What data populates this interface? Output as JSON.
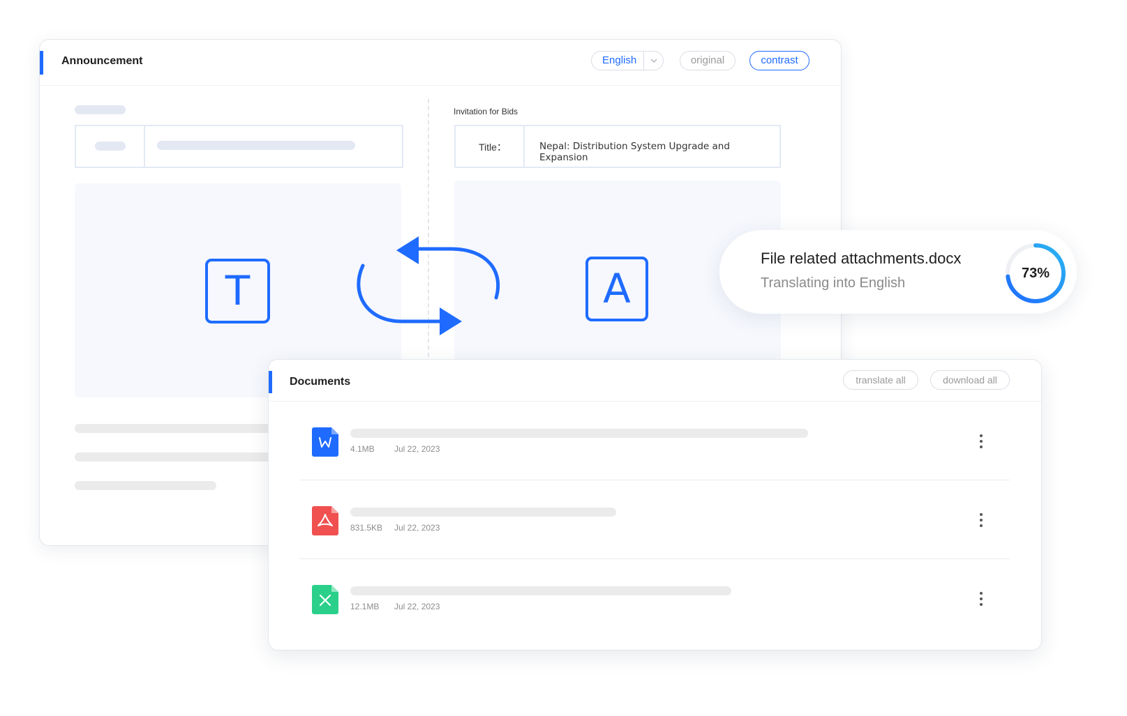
{
  "announcement": {
    "title": "Announcement",
    "language_select": "English",
    "original_label": "original",
    "contrast_label": "contrast",
    "section_label": "Invitation for Bids",
    "title_key": "Title：",
    "title_value": "Nepal: Distribution System Upgrade and Expansion",
    "source_letter": "T",
    "target_letter": "A"
  },
  "progress": {
    "filename": "File related attachments.docx",
    "status": "Translating into English",
    "percent_label": "73%",
    "percent": 73
  },
  "documents": {
    "title": "Documents",
    "translate_all": "translate all",
    "download_all": "download all",
    "files": [
      {
        "type": "word",
        "size": "4.1MB",
        "date": "Jul 22, 2023",
        "color": "#1f6bff"
      },
      {
        "type": "pdf",
        "size": "831.5KB",
        "date": "Jul 22, 2023",
        "color": "#f0504f"
      },
      {
        "type": "excel",
        "size": "12.1MB",
        "date": "Jul 22, 2023",
        "color": "#2ad08a"
      }
    ]
  },
  "colors": {
    "accent": "#1f6bff",
    "ring_track": "#f0f2f5"
  }
}
